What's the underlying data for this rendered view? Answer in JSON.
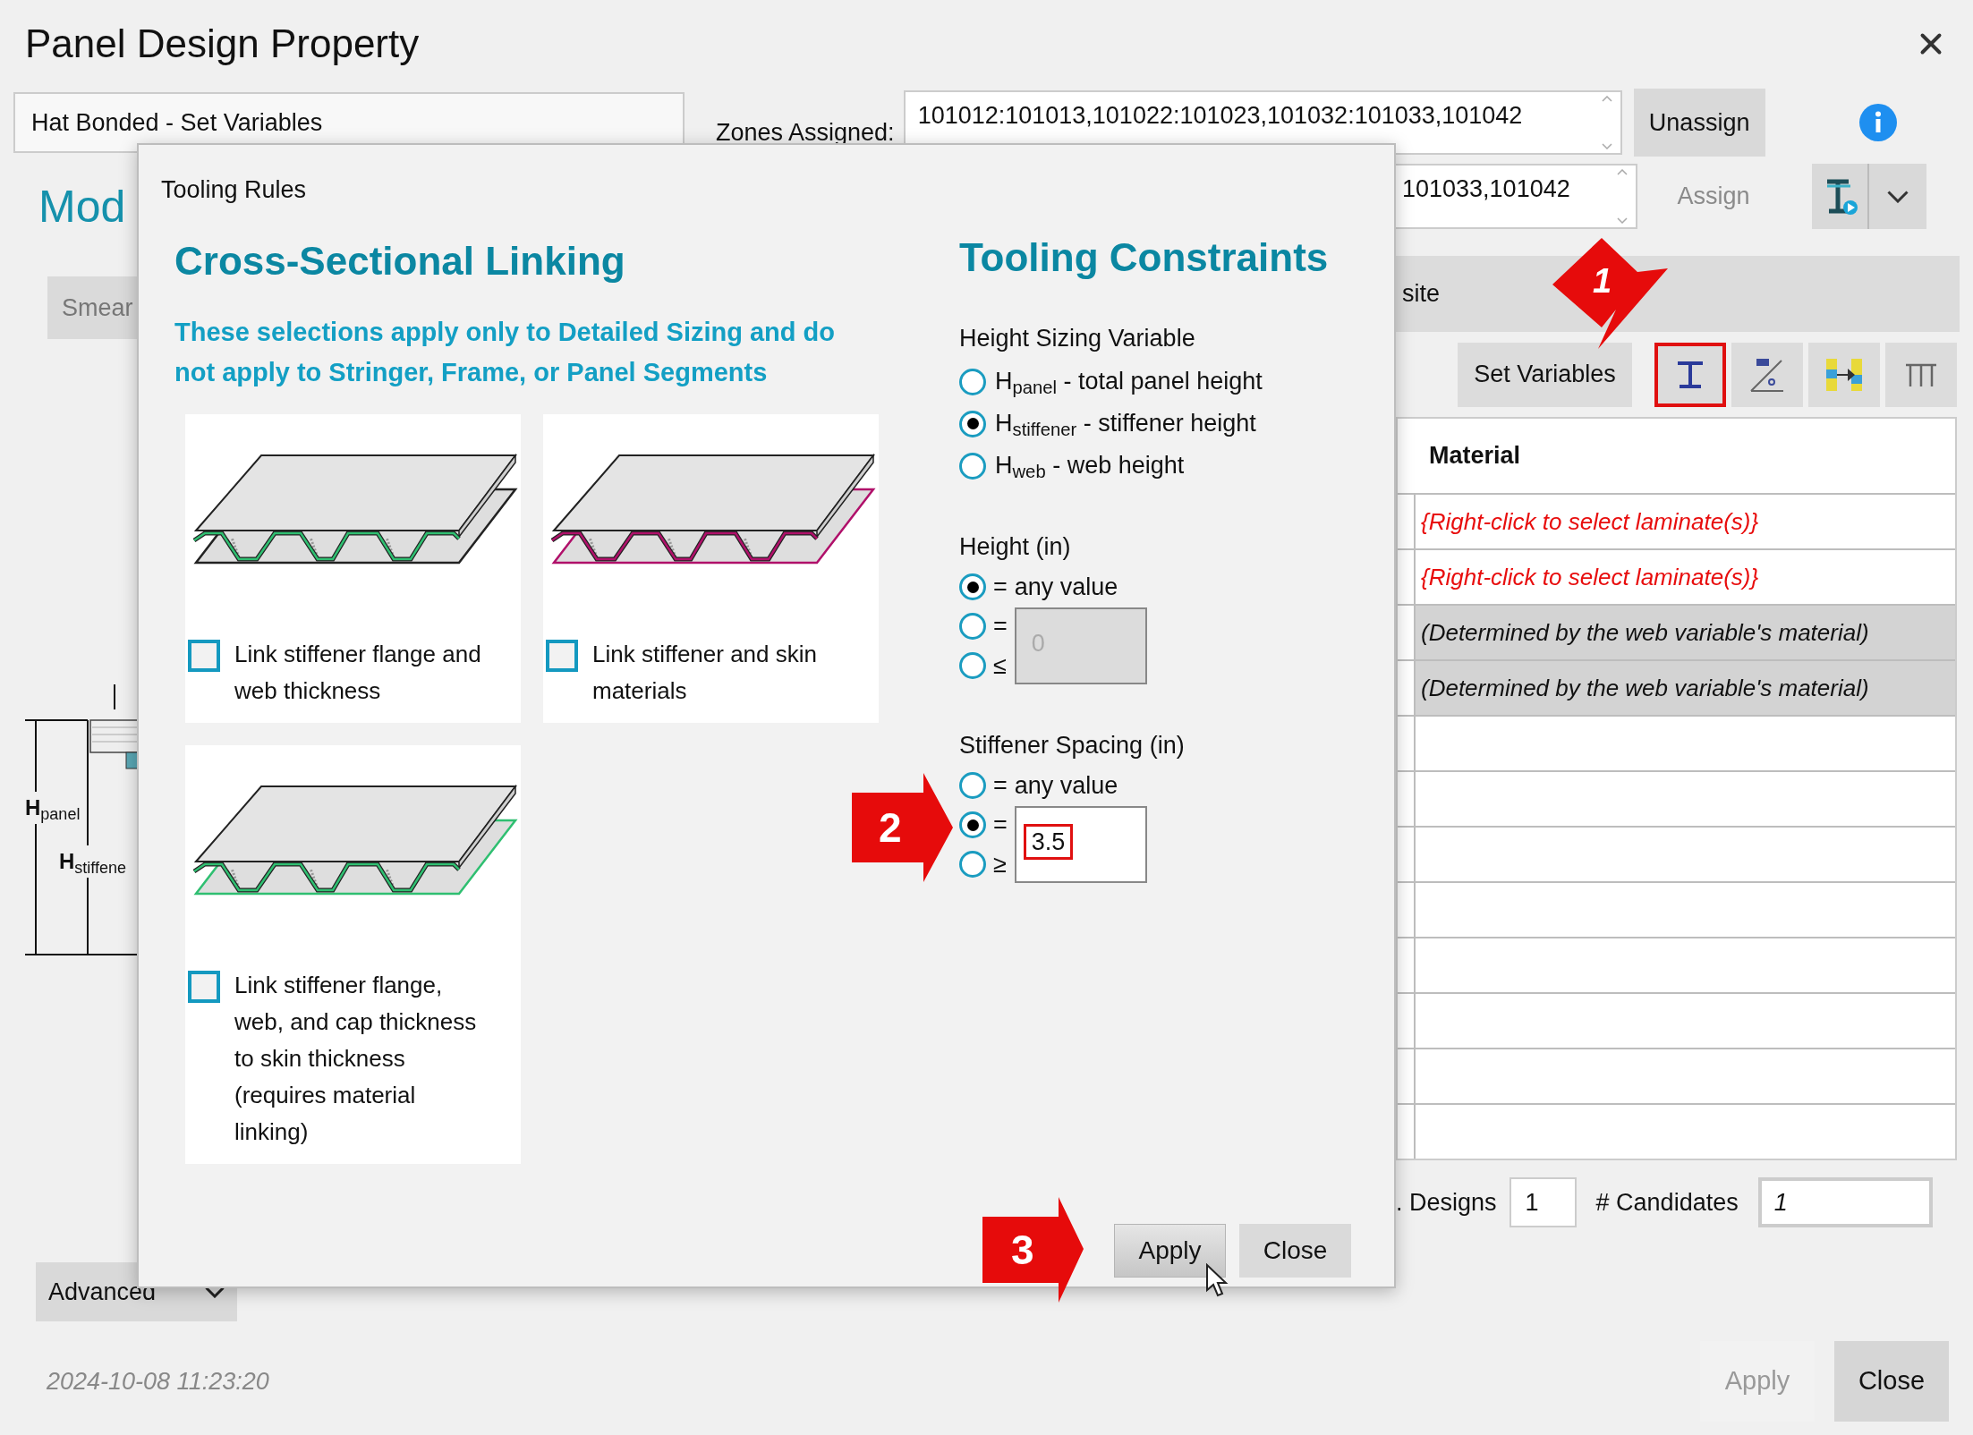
{
  "window": {
    "title": "Panel Design Property"
  },
  "design_name": "Hat Bonded - Set Variables",
  "zones": {
    "label": "Zones Assigned:",
    "value": "101012:101013,101022:101023,101032:101033,101042"
  },
  "unassign": "Unassign",
  "zones_2": {
    "value": "101033,101042"
  },
  "assign": {
    "label": "Assign",
    "disabled": true
  },
  "mode_heading": "Mod",
  "smear": "Smear",
  "diagram": {
    "labels": [
      "**H**$_{panel}$",
      "**H**$_{stiffene}$"
    ]
  },
  "advanced": "Advanced",
  "section_header": "site",
  "toolbar": {
    "set_variables": "Set Variables",
    "tools": [
      {
        "kind": "ibeam",
        "highlighted": true
      },
      {
        "kind": "angle",
        "highlighted": false
      },
      {
        "kind": "swap",
        "highlighted": false
      },
      {
        "kind": "columns",
        "highlighted": false
      }
    ]
  },
  "table": {
    "columns": [
      "Material"
    ],
    "rows": [
      {
        "kind": "prompt",
        "material": "{Right-click to select laminate(s)}"
      },
      {
        "kind": "prompt",
        "material": "{Right-click to select laminate(s)}"
      },
      {
        "kind": "derived",
        "material": "(Determined by the web variable's material)"
      },
      {
        "kind": "derived",
        "material": "(Determined by the web variable's material)"
      },
      {
        "kind": "empty"
      },
      {
        "kind": "empty"
      },
      {
        "kind": "empty"
      },
      {
        "kind": "empty"
      },
      {
        "kind": "empty"
      },
      {
        "kind": "empty"
      },
      {
        "kind": "empty"
      },
      {
        "kind": "empty"
      }
    ]
  },
  "designs": {
    "label": ". Designs",
    "value": "1"
  },
  "candidates": {
    "label": "# Candidates",
    "value": "1"
  },
  "timestamp": "2024-10-08 11:23:20",
  "footer_buttons": [
    {
      "label": "Apply",
      "disabled": true
    },
    {
      "label": "Close",
      "disabled": false
    }
  ],
  "dialog": {
    "title": "Tooling Rules",
    "linking": {
      "heading": "Cross-Sectional Linking",
      "note": "These selections apply only to Detailed Sizing and do not apply to Stringer, Frame, or Panel Segments",
      "options": [
        {
          "label": "Link stiffener flange and web thickness",
          "checked": false,
          "color": "#2fbf71",
          "skin_linked": false
        },
        {
          "label": "Link stiffener and skin materials",
          "checked": false,
          "color": "#b0106a",
          "skin_linked": true
        },
        {
          "label": "Link stiffener flange, web, and cap thickness to skin thickness (requires material linking)",
          "checked": false,
          "color": "#2fbf71",
          "skin_linked": true
        }
      ]
    },
    "constraints": {
      "heading": "Tooling Constraints",
      "groups": [
        {
          "kind": "choice",
          "label": "Height Sizing Variable",
          "options": [
            {
              "text": "H$_{panel}$ - total panel height",
              "selected": false
            },
            {
              "text": "H$_{stiffener}$ - stiffener height",
              "selected": true
            },
            {
              "text": "H$_{web}$ - web height",
              "selected": false
            }
          ]
        },
        {
          "kind": "bound",
          "label": "Height (in)",
          "options": [
            {
              "symbol": "=",
              "text": "any value",
              "selected": true
            },
            {
              "symbol": "=",
              "selected": false
            },
            {
              "symbol": "≤",
              "selected": false
            }
          ],
          "field": {
            "value": "0",
            "disabled": true,
            "highlighted": false
          }
        },
        {
          "kind": "bound",
          "label": "Stiffener Spacing (in)",
          "options": [
            {
              "symbol": "=",
              "text": "any value",
              "selected": false
            },
            {
              "symbol": "=",
              "selected": true
            },
            {
              "symbol": "≥",
              "selected": false
            }
          ],
          "field": {
            "value": "3.5",
            "disabled": false,
            "highlighted": true
          }
        }
      ]
    },
    "buttons": [
      {
        "label": "Apply",
        "hovered": true
      },
      {
        "label": "Close",
        "hovered": false
      }
    ]
  },
  "callouts": [
    "1",
    "2",
    "3"
  ]
}
